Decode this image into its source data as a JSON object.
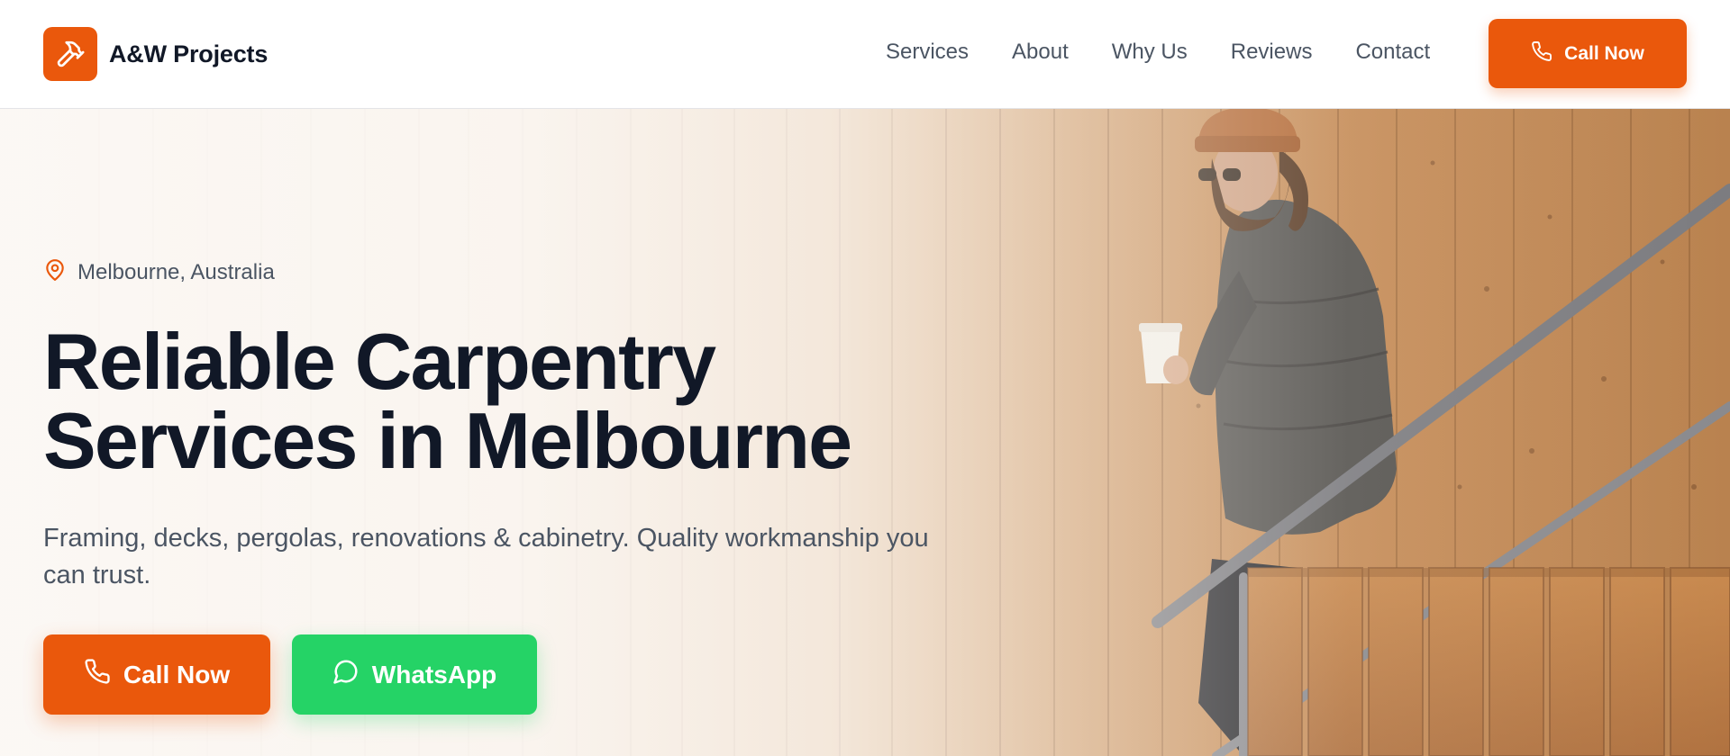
{
  "brand": {
    "name": "A&W Projects",
    "logo_icon": "hammer-icon",
    "accent": "#ea580c"
  },
  "nav": {
    "items": [
      {
        "label": "Services"
      },
      {
        "label": "About"
      },
      {
        "label": "Why Us"
      },
      {
        "label": "Reviews"
      },
      {
        "label": "Contact"
      }
    ]
  },
  "header_cta": {
    "label": "Call Now",
    "icon": "phone-icon"
  },
  "hero": {
    "location": "Melbourne, Australia",
    "location_icon": "map-pin-icon",
    "headline_line1": "Reliable Carpentry",
    "headline_line2": "Services in Melbourne",
    "subheadline": "Framing, decks, pergolas, renovations & cabinetry. Quality workmanship you can trust.",
    "primary_button": {
      "label": "Call Now",
      "icon": "phone-icon",
      "color": "#ea580c"
    },
    "secondary_button": {
      "label": "WhatsApp",
      "icon": "chat-bubble-icon",
      "color": "#25d366"
    }
  }
}
